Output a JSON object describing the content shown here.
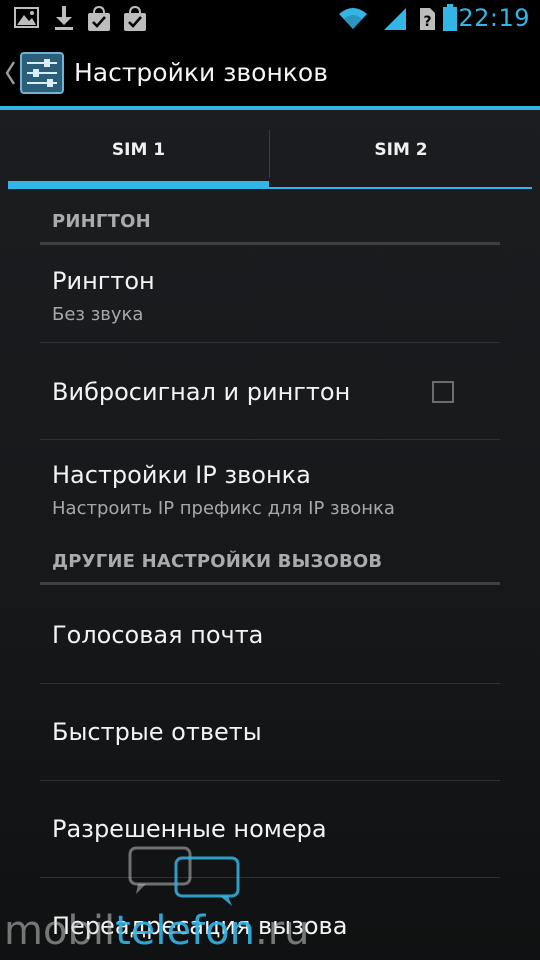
{
  "status_bar": {
    "time": "22:19",
    "icons": [
      "gallery-icon",
      "download-icon",
      "market-icon",
      "market-icon",
      "wifi-icon",
      "signal-icon",
      "sim-unknown-icon",
      "battery-icon"
    ]
  },
  "action_bar": {
    "title": "Настройки звонков",
    "icon": "settings-sliders-icon"
  },
  "tabs": [
    {
      "label": "SIM 1",
      "selected": true
    },
    {
      "label": "SIM 2",
      "selected": false
    }
  ],
  "sections": [
    {
      "header": "РИНГТОН",
      "items": [
        {
          "title": "Рингтон",
          "subtitle": "Без звука"
        },
        {
          "title": "Вибросигнал и рингтон",
          "checked": false
        },
        {
          "title": "Настройки IP звонка",
          "subtitle": "Настроить IP префикс для IP звонка"
        }
      ]
    },
    {
      "header": "ДРУГИЕ НАСТРОЙКИ ВЫЗОВОВ",
      "items": [
        {
          "title": "Голосовая почта"
        },
        {
          "title": "Быстрые ответы"
        },
        {
          "title": "Разрешенные номера"
        },
        {
          "title": "Переадресация вызова"
        }
      ]
    }
  ],
  "watermark": {
    "part1": "mobil",
    "part2": "telefon",
    "part3": ".ru"
  },
  "colors": {
    "accent": "#33b5e5",
    "background": "#1a1c1e",
    "header_text": "#a9acaf"
  }
}
